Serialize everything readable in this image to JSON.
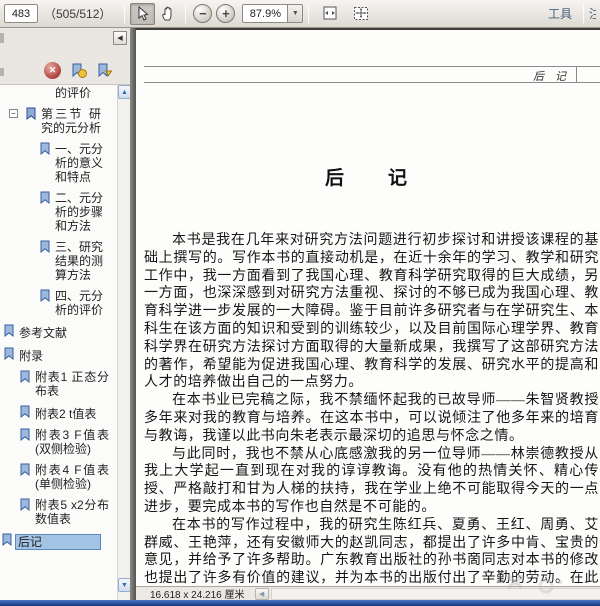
{
  "toolbar": {
    "page_input": "483",
    "page_indicator": "（505/512）",
    "zoom_minus": "−",
    "zoom_plus": "+",
    "zoom_value": "87.9%",
    "zoom_dropdown": "▼",
    "tools_label": "工具",
    "tools_label_partial": "注"
  },
  "sidebar": {
    "collapse_button": "◀",
    "delete_button": "✕",
    "scroll_up": "▲",
    "scroll_down": "▼",
    "expander_collapse": "−",
    "items": [
      {
        "label": "五、结论的评价"
      },
      {
        "label": "第三节 研究的元分析"
      },
      {
        "label": "一、元分析的意义和特点"
      },
      {
        "label": "二、元分析的步骤和方法"
      },
      {
        "label": "三、研究结果的测算方法"
      },
      {
        "label": "四、元分析的评价"
      },
      {
        "label": "参考文献"
      },
      {
        "label": "附录"
      },
      {
        "label": "附表1 正态分布表"
      },
      {
        "label": "附表2 t值表"
      },
      {
        "label": "附表3 F值表(双侧检验)"
      },
      {
        "label": "附表4 F值表(单侧检验)"
      },
      {
        "label": "附表5 x2分布数值表"
      },
      {
        "label": "后记"
      }
    ]
  },
  "document": {
    "running_header": "后　记",
    "title": "后　　记",
    "paragraphs": [
      "本书是我在几年来对研究方法问题进行初步探讨和讲授该课程的基础上撰写的。写作本书的直接动机是，在近十余年的学习、教学和研究工作中，我一方面看到了我国心理、教育科学研究取得的巨大成绩，另一方面，也深深感到对研究方法重视、探讨的不够已成为我国心理、教育科学进一步发展的一大障碍。鉴于目前许多研究者与在学研究生、本科生在该方面的知识和受到的训练较少，以及目前国际心理学界、教育科学界在研究方法探讨方面取得的大量新成果，我撰写了这部研究方法的著作，希望能为促进我国心理、教育科学的发展、研究水平的提高和人才的培养做出自己的一点努力。",
      "在本书业已完稿之际，我不禁缅怀起我的已故导师——朱智贤教授多年来对我的教育与培养。在这本书中，可以说倾注了他多年来的培育与教诲，我谨以此书向朱老表示最深切的追思与怀念之情。",
      "与此同时，我也不禁从心底感激我的另一位导师——林崇德教授从我上大学起一直到现在对我的谆谆教诲。没有他的热情关怀、精心传授、严格敲打和甘为人梯的扶持，我在学业上绝不可能取得今天的一点进步，要完成本书的写作也自然是不可能的。",
      "在本书的写作过程中，我的研究生陈红兵、夏勇、王红、周勇、艾群威、王艳萍，还有安徽师大的赵凯同志，都提出了许多中肯、宝贵的意见，并给予了许多帮助。广东教育出版社的孙书啇同志对本书的修改也提出了许多有价值的建议，并为本书的出版付出了辛勤的劳动。在此一并表示衷心的感谢。"
    ]
  },
  "statusbar": {
    "page_dimensions": "16.618 x 24.216 厘米",
    "scroll_left": "◀"
  }
}
